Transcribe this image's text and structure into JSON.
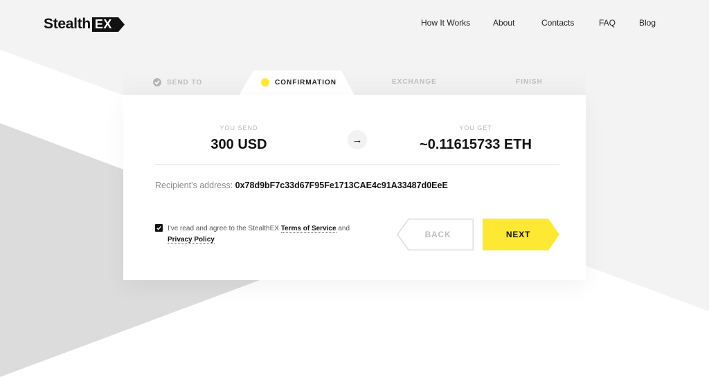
{
  "brand": {
    "name_part1": "Stealth",
    "name_part2": "EX"
  },
  "nav": {
    "items": [
      {
        "label": "How It Works"
      },
      {
        "label": "About"
      },
      {
        "label": "Contacts"
      },
      {
        "label": "FAQ"
      },
      {
        "label": "Blog"
      }
    ]
  },
  "steps": {
    "items": [
      {
        "label": "SEND TO",
        "state": "completed",
        "icon": "check-circle-icon"
      },
      {
        "label": "CONFIRMATION",
        "state": "active",
        "icon": "yellow-dot-icon"
      },
      {
        "label": "EXCHANGE",
        "state": "pending"
      },
      {
        "label": "FINISH",
        "state": "pending"
      }
    ]
  },
  "exchange": {
    "send_label": "YOU SEND",
    "send_amount": "300 USD",
    "arrow_icon": "arrow-right-icon",
    "get_label": "YOU GET",
    "get_amount": "~0.11615733 ETH"
  },
  "recipient": {
    "label": "Recipient's address:",
    "address": "0x78d9bF7c33d67F95Fe1713CAE4c91A33487d0EeE"
  },
  "agreement": {
    "checked": true,
    "text_before": "I've read and agree to the StealthEX ",
    "terms_link": "Terms of Service",
    "text_between": " and",
    "privacy_link": "Privacy Policy"
  },
  "buttons": {
    "back_label": "BACK",
    "next_label": "NEXT"
  },
  "colors": {
    "accent": "#fde833",
    "background": "#f3f3f3",
    "triangle": "#dcdcdc"
  }
}
